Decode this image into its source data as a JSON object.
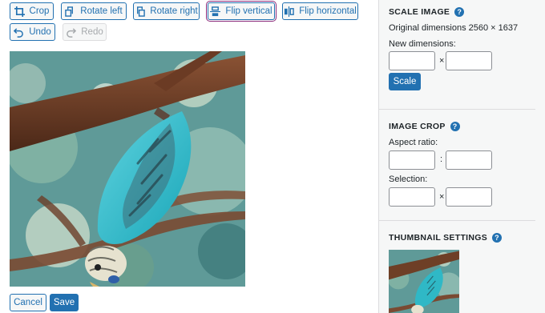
{
  "toolbar": {
    "crop": "Crop",
    "rotate_left": "Rotate left",
    "rotate_right": "Rotate right",
    "flip_vertical": "Flip vertical",
    "flip_horizontal": "Flip horizontal",
    "undo": "Undo",
    "redo": "Redo"
  },
  "actions": {
    "cancel": "Cancel",
    "save": "Save"
  },
  "scale_image": {
    "title": "SCALE IMAGE",
    "original": "Original dimensions 2560 × 1637",
    "new_dimensions": "New dimensions:",
    "width_value": "",
    "height_value": "",
    "times": "×",
    "scale_button": "Scale"
  },
  "image_crop": {
    "title": "IMAGE CROP",
    "aspect_ratio": "Aspect ratio:",
    "colon": ":",
    "selection": "Selection:",
    "times": "×"
  },
  "thumbnail": {
    "title": "THUMBNAIL SETTINGS"
  },
  "help_glyph": "?",
  "colors": {
    "accent": "#2271b1",
    "selected_outline": "#8c2a7a",
    "panel_bg": "#f6f7f7"
  }
}
